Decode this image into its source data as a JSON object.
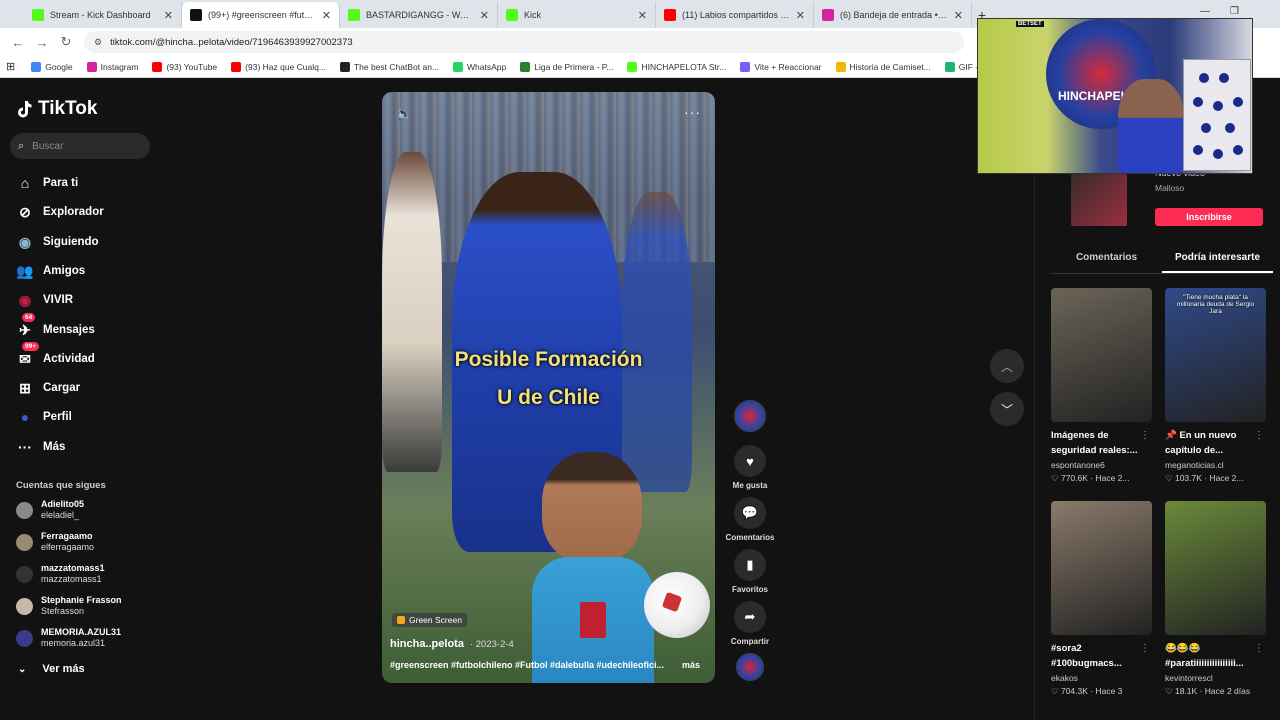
{
  "browser": {
    "tabs": [
      {
        "title": "Stream - Kick Dashboard",
        "fav_color": "#53fc18",
        "active": false
      },
      {
        "title": "(99+) #greenscreen #futbol",
        "fav_color": "#111111",
        "active": true
      },
      {
        "title": "BASTARDIGANGG - Watch clip",
        "fav_color": "#53fc18",
        "active": false
      },
      {
        "title": "Kick",
        "fav_color": "#53fc18",
        "active": false
      },
      {
        "title": "(11) Labios compartidos - Los",
        "fav_color": "#ff0000",
        "active": false
      },
      {
        "title": "(6) Bandeja de entrada • Chats",
        "fav_color": "#d6249f",
        "active": false
      }
    ],
    "new_tab": "+",
    "url": "tiktok.com/@hincha..pelota/video/7196463939927002373",
    "bookmarks": [
      {
        "label": "Google",
        "color": "#4285f4"
      },
      {
        "label": "Instagram",
        "color": "#d6249f"
      },
      {
        "label": "(93) YouTube",
        "color": "#ff0000"
      },
      {
        "label": "(93) Haz que Cualq...",
        "color": "#ff0000"
      },
      {
        "label": "The best ChatBot an...",
        "color": "#222222"
      },
      {
        "label": "WhatsApp",
        "color": "#25d366"
      },
      {
        "label": "Liga de Primera - P...",
        "color": "#2e7d32"
      },
      {
        "label": "HINCHAPELOTA Str...",
        "color": "#53fc18"
      },
      {
        "label": "Vite + Reaccionar",
        "color": "#7b5cff"
      },
      {
        "label": "Historia de Camiset...",
        "color": "#f2b705"
      },
      {
        "label": "GIF - Imgur",
        "color": "#1bb76e"
      }
    ]
  },
  "leftnav": {
    "brand": "TikTok",
    "search_placeholder": "Buscar",
    "items": [
      {
        "label": "Para ti",
        "icon": "home-icon"
      },
      {
        "label": "Explorador",
        "icon": "compass-icon"
      },
      {
        "label": "Siguiendo",
        "icon": "following-avatar-icon"
      },
      {
        "label": "Amigos",
        "icon": "friends-icon"
      },
      {
        "label": "VIVIR",
        "icon": "live-icon"
      },
      {
        "label": "Mensajes",
        "icon": "messages-icon",
        "badge": "64"
      },
      {
        "label": "Actividad",
        "icon": "activity-icon",
        "badge": "99+"
      },
      {
        "label": "Cargar",
        "icon": "upload-icon"
      },
      {
        "label": "Perfil",
        "icon": "profile-icon"
      },
      {
        "label": "Más",
        "icon": "more-icon"
      }
    ],
    "following_header": "Cuentas que sigues",
    "following": [
      {
        "name": "Adielito05",
        "handle": "eleladiel_",
        "color": "#8a8a8a"
      },
      {
        "name": "Ferragaamo",
        "handle": "elferragaamo",
        "color": "#9a8a70"
      },
      {
        "name": "mazzatomass1",
        "handle": "mazzatomass1",
        "color": "#333333"
      },
      {
        "name": "Stephanie Frasson",
        "handle": "Stefrasson",
        "color": "#c8b8a8"
      },
      {
        "name": "MEMORIA.AZUL31",
        "handle": "memoria.azul31",
        "color": "#3a3a8a"
      }
    ],
    "see_more": "Ver más"
  },
  "video": {
    "overlay_line1": "Posible Formación",
    "overlay_line2": "U de Chile",
    "green_screen": "Green Screen",
    "author": "hincha..pelota",
    "date": "· 2023-2-4",
    "caption": "#greenscreen #futbolchileno #Futbol #dalebulla #udechileofici...",
    "more": "más"
  },
  "actions": {
    "like": "Me gusta",
    "comments": "Comentarios",
    "favorites": "Favoritos",
    "share": "Compartir"
  },
  "rightpanel": {
    "promo_text": "Nuevo video",
    "promo_sub": "Malloso",
    "subscribe": "Inscribirse",
    "tabs": [
      "Comentarios",
      "Podría interesarte"
    ],
    "cards": [
      {
        "title": "Imágenes de seguridad reales:...",
        "user": "espontanone6",
        "stats": "♡ 770.6K · Hace 2...",
        "thumb": "#6b6458",
        "thumb_text": ""
      },
      {
        "title": "📌 En un nuevo capítulo de...",
        "user": "meganoticias.cl",
        "stats": "♡ 103.7K · Hace 2...",
        "thumb": "#2f4a8a",
        "thumb_text": "\"Tiene mucha plata\" la millonaria deuda de Sergio Jara"
      },
      {
        "title": "#sora2 #100bugmacs...",
        "user": "ekakos",
        "stats": "♡ 704.3K · Hace 3",
        "thumb": "#8a7a6a",
        "thumb_text": ""
      },
      {
        "title": "😂😂😂 #paratiiiiiiiiiiiiiiii...",
        "user": "kevintorrescl",
        "stats": "♡ 18.1K · Hace 2 días",
        "thumb": "#6a8a3a",
        "thumb_text": ""
      }
    ]
  },
  "webcam": {
    "banner_text": "HINCHAPELOTA",
    "brand": "BETSET"
  }
}
